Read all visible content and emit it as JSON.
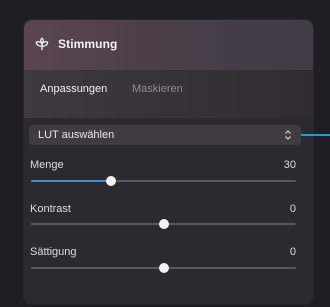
{
  "header": {
    "title": "Stimmung",
    "icon": "flower-icon"
  },
  "tabs": {
    "active": "Anpassungen",
    "inactive": "Maskieren"
  },
  "lut": {
    "label": "LUT auswählen",
    "icon": "chevron-up-down-icon"
  },
  "sliders": [
    {
      "label": "Menge",
      "value": "30",
      "position": 0.3,
      "filled": true
    },
    {
      "label": "Kontrast",
      "value": "0",
      "position": 0.5,
      "filled": false
    },
    {
      "label": "Sättigung",
      "value": "0",
      "position": 0.5,
      "filled": false
    }
  ],
  "colors": {
    "accent": "#3b8fd0",
    "callout": "#1f9bd6"
  }
}
